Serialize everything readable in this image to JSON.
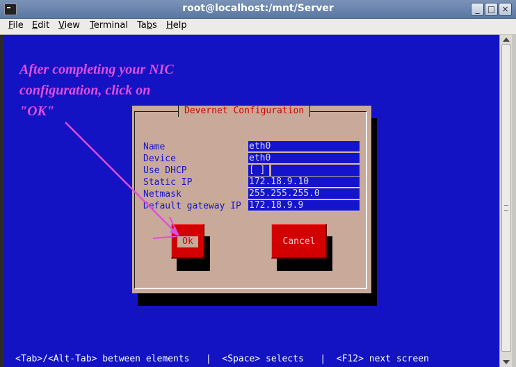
{
  "window": {
    "title": "root@localhost:/mnt/Server",
    "controls": {
      "minimize": "_",
      "maximize": "□",
      "close": "×"
    }
  },
  "menu": [
    {
      "label": "File",
      "u": "F",
      "rest": "ile"
    },
    {
      "label": "Edit",
      "u": "E",
      "rest": "dit"
    },
    {
      "label": "View",
      "u": "V",
      "rest": "iew"
    },
    {
      "label": "Terminal",
      "u": "T",
      "rest": "erminal"
    },
    {
      "label": "Tabs",
      "pre": "Ta",
      "u": "b",
      "rest": "s"
    },
    {
      "label": "Help",
      "u": "H",
      "rest": "elp"
    }
  ],
  "annotation": {
    "line1": "After completing your NIC",
    "line2": "configuration, click on",
    "line3": "\"OK\"",
    "color": "#e14de0"
  },
  "dialog": {
    "title": "Devernet Configuration",
    "fields": {
      "name": {
        "label": "Name",
        "value": "eth0"
      },
      "device": {
        "label": "Device",
        "value": "eth0"
      },
      "dhcp": {
        "label": "Use DHCP",
        "value": "[ ]"
      },
      "static_ip": {
        "label": "Static IP",
        "value": "172.18.9.10"
      },
      "netmask": {
        "label": "Netmask",
        "value": "255.255.255.0"
      },
      "gateway": {
        "label": "Default gateway IP",
        "value": "172.18.9.9"
      }
    },
    "ok_label": "Ok",
    "cancel_label": "Cancel"
  },
  "status": {
    "tab": "<Tab>/<Alt-Tab> between elements",
    "sep1": "|",
    "space": "<Space> selects",
    "sep2": "|",
    "f12": "<F12> next screen"
  },
  "colors": {
    "terminal_bg": "#1313c4",
    "dialog_bg": "#c8a99a",
    "button_red": "#d20000",
    "label_blue": "#1616c8"
  }
}
